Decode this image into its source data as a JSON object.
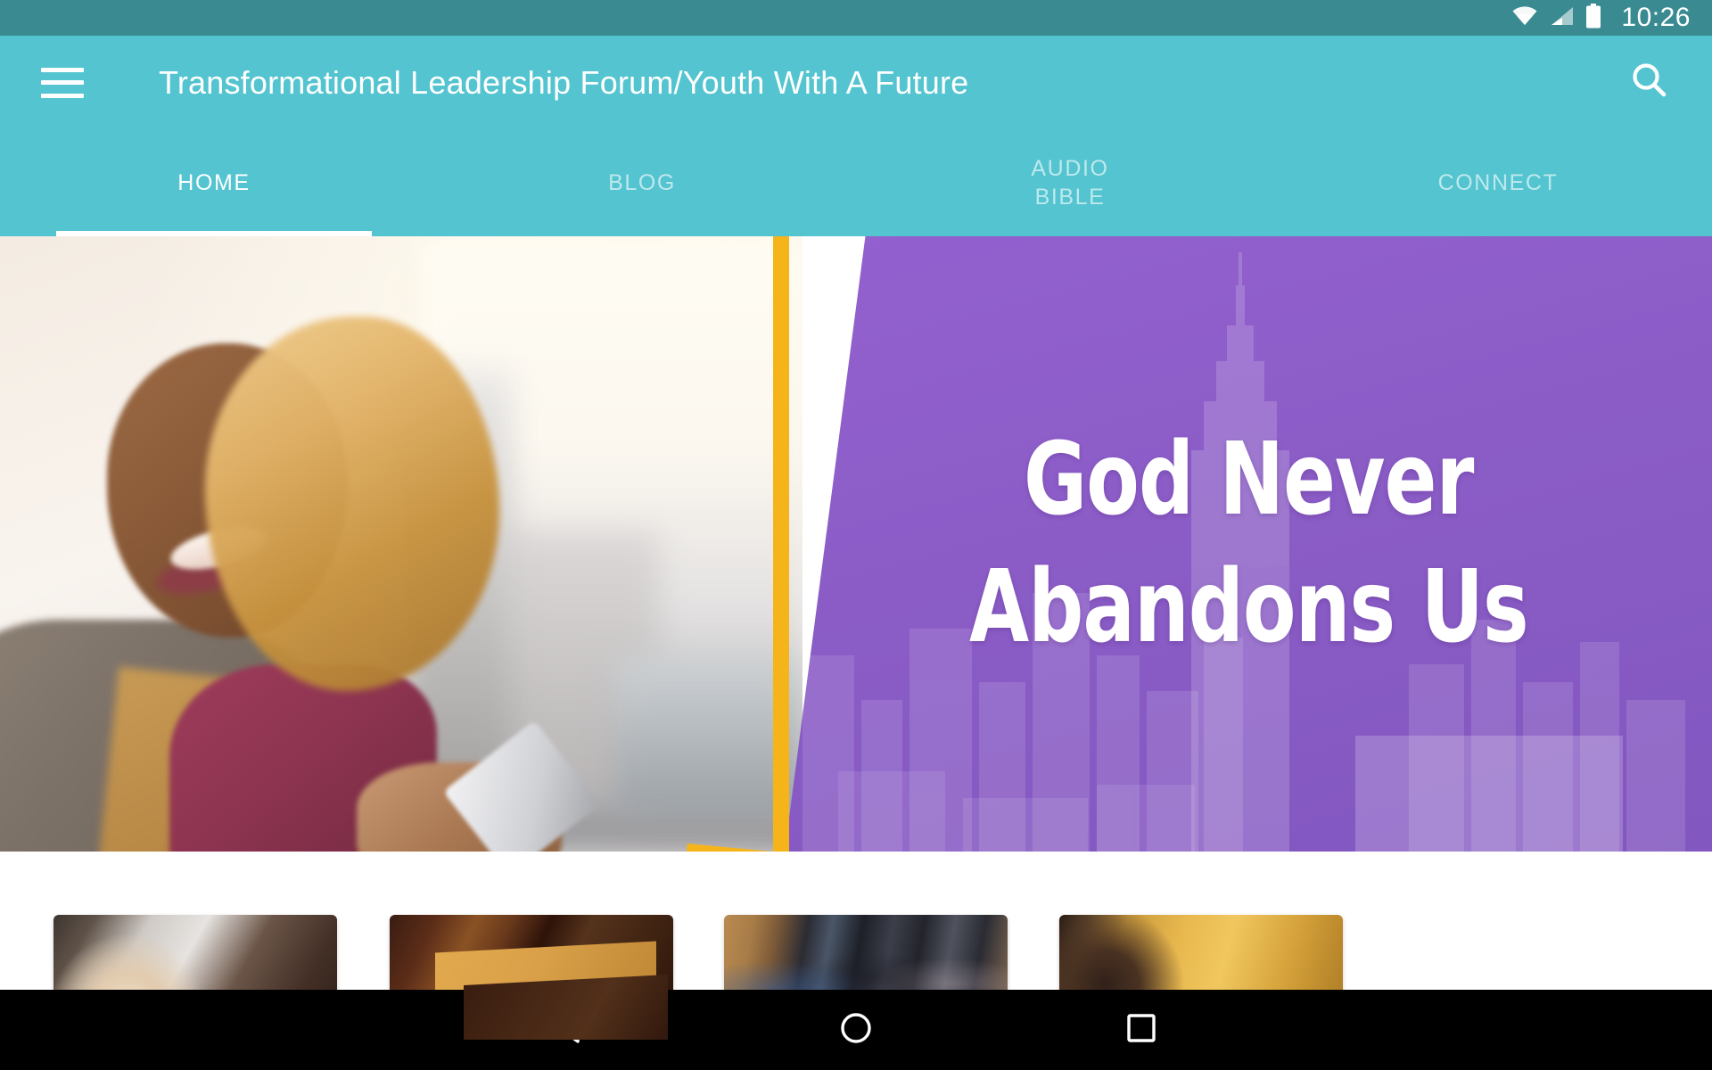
{
  "statusbar": {
    "time": "10:26",
    "icons": [
      "wifi-icon",
      "cellular-signal-icon",
      "battery-icon"
    ]
  },
  "appbar": {
    "menu_icon": "hamburger-menu-icon",
    "title": "Transformational Leadership Forum/Youth With A Future",
    "search_icon": "search-icon",
    "background_color": "#53c4d0"
  },
  "tabs": {
    "active_index": 0,
    "items": [
      {
        "label": "HOME",
        "name": "tab-home"
      },
      {
        "label": "BLOG",
        "name": "tab-blog"
      },
      {
        "label": "AUDIO\nBIBLE",
        "name": "tab-audio-bible"
      },
      {
        "label": "CONNECT",
        "name": "tab-connect"
      }
    ]
  },
  "hero": {
    "headline_line1": "God Never",
    "headline_line2": "Abandons Us",
    "left_image_alt": "smiling-woman-with-phone-photo",
    "right_image_alt": "city-skyline-purple-overlay",
    "accent_color": "#f5b51a",
    "overlay_color": "#8b5cc6"
  },
  "cards": [
    {
      "name": "card-item-1",
      "alt": "blurred-indoor-light-photo"
    },
    {
      "name": "card-item-2",
      "alt": "framed-picture-photo"
    },
    {
      "name": "card-item-3",
      "alt": "youth-group-photo"
    },
    {
      "name": "card-item-4",
      "alt": "woman-golden-background-photo"
    }
  ],
  "navbar": {
    "back_icon": "back-triangle-icon",
    "home_icon": "home-circle-icon",
    "recents_icon": "recents-square-icon",
    "background_color": "#000000"
  }
}
